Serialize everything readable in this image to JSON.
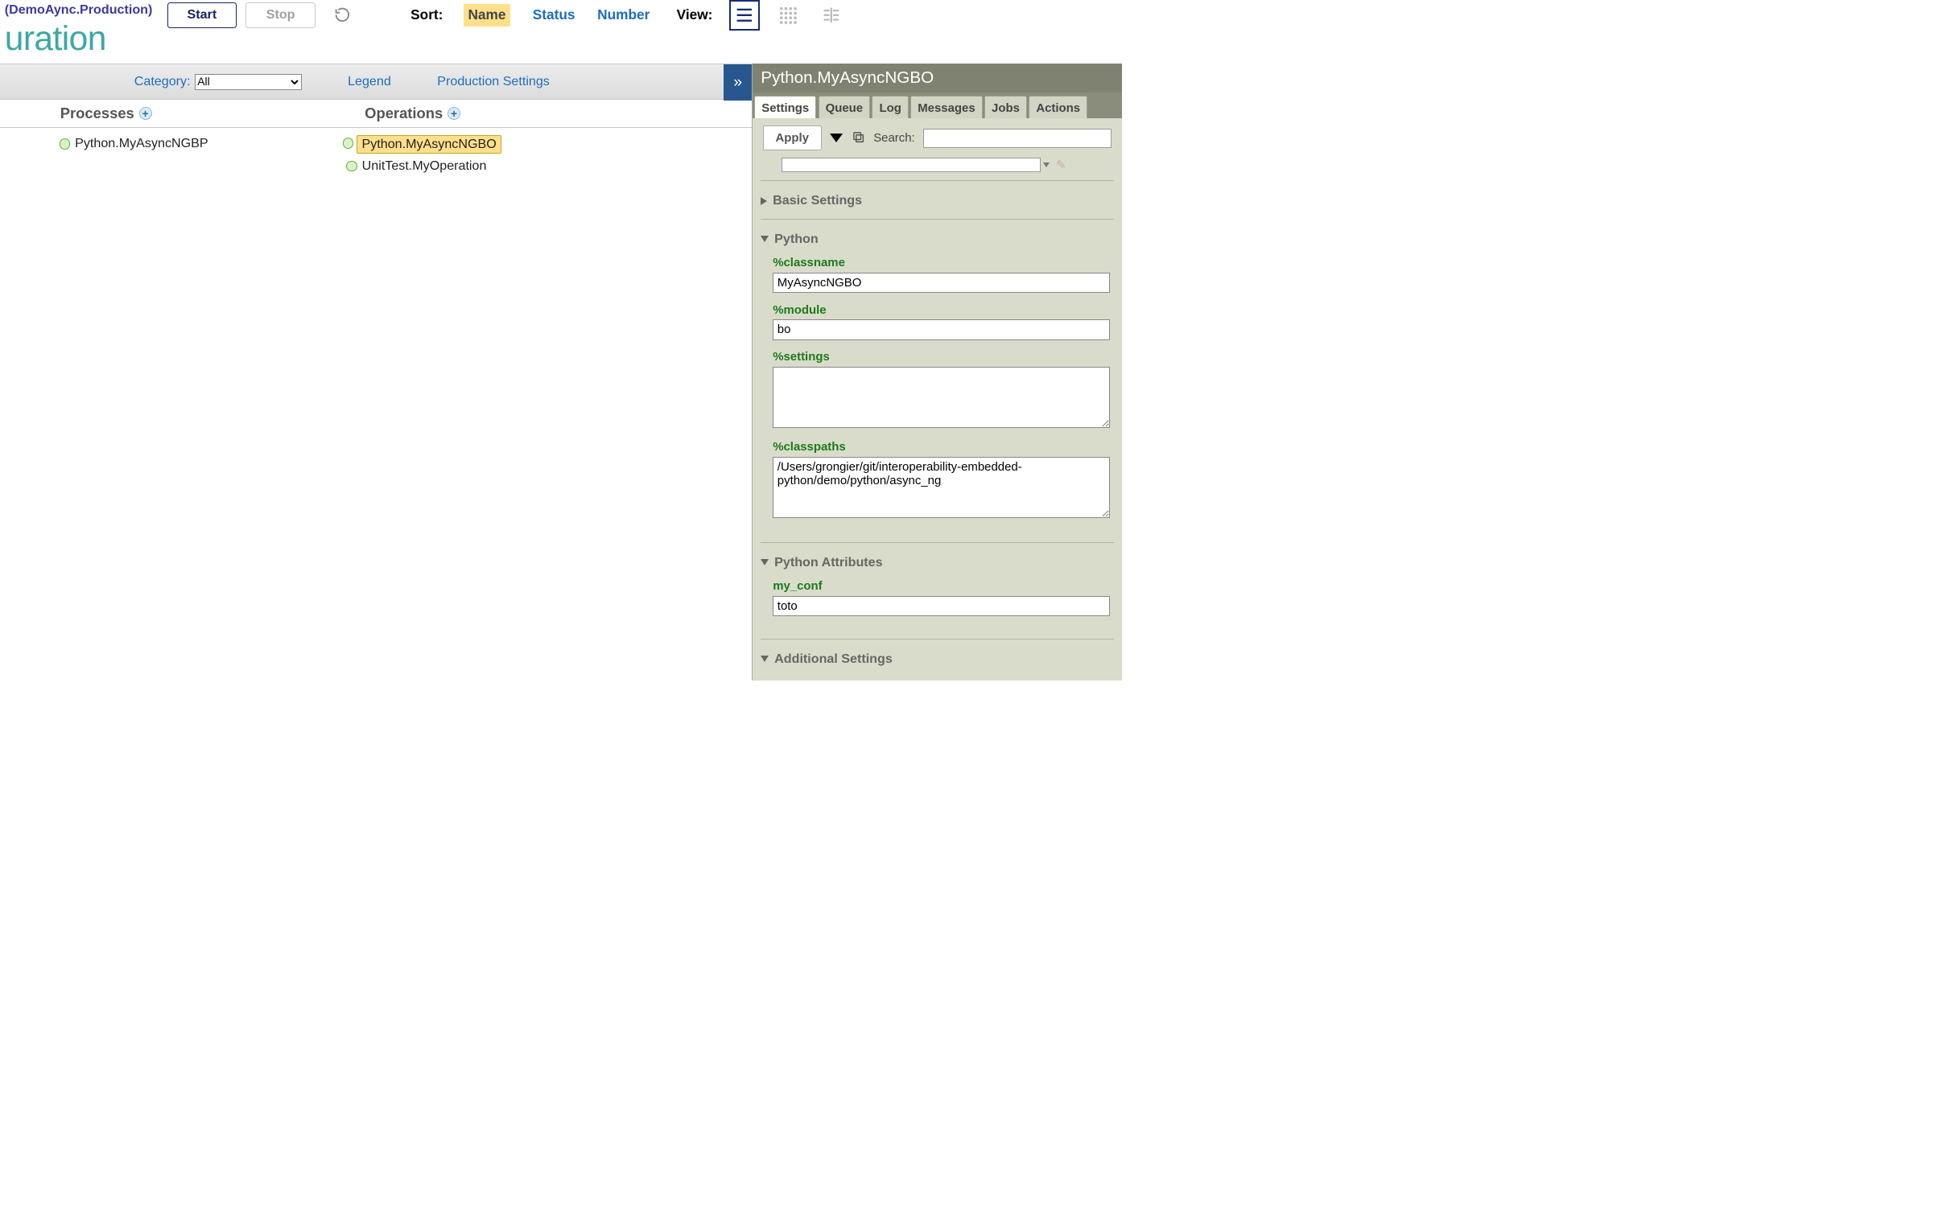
{
  "breadcrumb": "(DemoAync.Production)",
  "page_title": "uration",
  "buttons": {
    "start": "Start",
    "stop": "Stop"
  },
  "sort_label": "Sort:",
  "sort_options": {
    "name": "Name",
    "status": "Status",
    "number": "Number"
  },
  "view_label": "View:",
  "category_label": "Category:",
  "category_value": "All",
  "legend_link": "Legend",
  "prodset_link": "Production Settings",
  "columns": {
    "processes": "Processes",
    "operations": "Operations"
  },
  "nodes": {
    "processes": [
      {
        "name": "Python.MyAsyncNGBP",
        "selected": false
      }
    ],
    "operations": [
      {
        "name": "Python.MyAsyncNGBO",
        "selected": true
      },
      {
        "name": "UnitTest.MyOperation",
        "selected": false
      }
    ]
  },
  "side": {
    "title": "Python.MyAsyncNGBO",
    "tabs": [
      "Settings",
      "Queue",
      "Log",
      "Messages",
      "Jobs",
      "Actions"
    ],
    "apply": "Apply",
    "search_label": "Search:",
    "search_value": "",
    "sections": {
      "basic_title": "Basic Settings",
      "python_title": "Python",
      "pyattr_title": "Python Attributes",
      "additional_title": "Additional Settings"
    },
    "fields": {
      "classname_label": "%classname",
      "classname_value": "MyAsyncNGBO",
      "module_label": "%module",
      "module_value": "bo",
      "settings_label": "%settings",
      "settings_value": "",
      "classpaths_label": "%classpaths",
      "classpaths_value": "/Users/grongier/git/interoperability-embedded-python/demo/python/async_ng",
      "myconf_label": "my_conf",
      "myconf_value": "toto"
    }
  }
}
